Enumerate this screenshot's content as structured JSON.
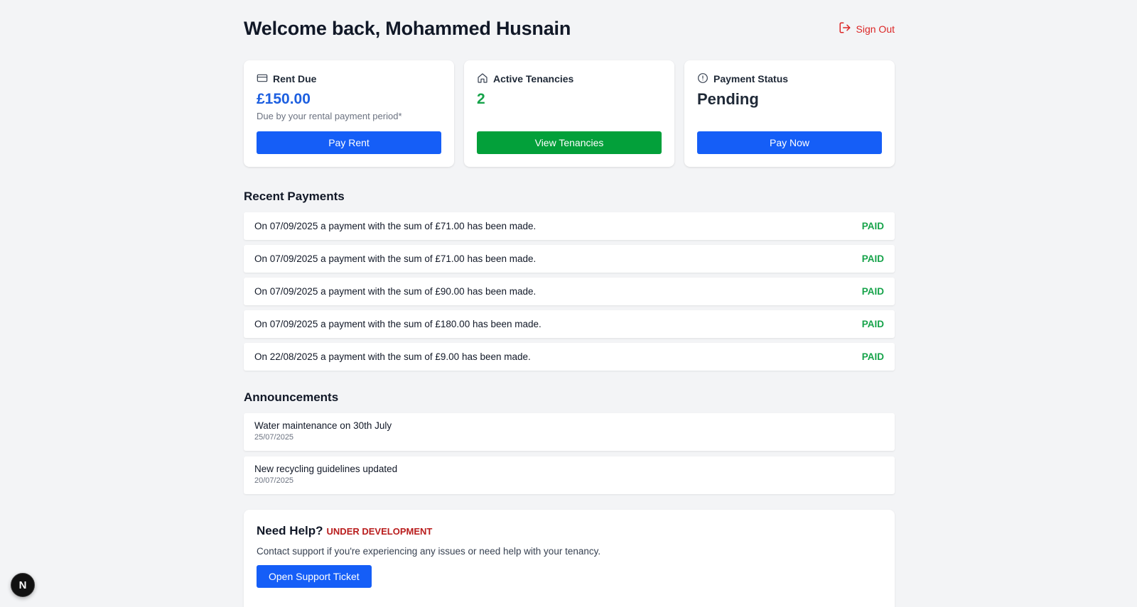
{
  "header": {
    "title": "Welcome back, Mohammed Husnain",
    "sign_out_label": "Sign Out"
  },
  "cards": {
    "rent_due": {
      "title": "Rent Due",
      "value": "£150.00",
      "subtitle": "Due by your rental payment period*",
      "button": "Pay Rent",
      "icon": "credit-card-icon"
    },
    "active_tenancies": {
      "title": "Active Tenancies",
      "value": "2",
      "button": "View Tenancies",
      "icon": "home-icon"
    },
    "payment_status": {
      "title": "Payment Status",
      "value": "Pending",
      "button": "Pay Now",
      "icon": "alert-circle-icon"
    }
  },
  "recent_payments": {
    "title": "Recent Payments",
    "items": [
      {
        "text": "On 07/09/2025 a payment with the sum of £71.00 has been made.",
        "status": "PAID"
      },
      {
        "text": "On 07/09/2025 a payment with the sum of £71.00 has been made.",
        "status": "PAID"
      },
      {
        "text": "On 07/09/2025 a payment with the sum of £90.00 has been made.",
        "status": "PAID"
      },
      {
        "text": "On 07/09/2025 a payment with the sum of £180.00 has been made.",
        "status": "PAID"
      },
      {
        "text": "On 22/08/2025 a payment with the sum of £9.00 has been made.",
        "status": "PAID"
      }
    ]
  },
  "announcements": {
    "title": "Announcements",
    "items": [
      {
        "text": "Water maintenance on 30th July",
        "date": "25/07/2025"
      },
      {
        "text": "New recycling guidelines updated",
        "date": "20/07/2025"
      }
    ]
  },
  "help": {
    "title": "Need Help?",
    "badge": "UNDER DEVELOPMENT",
    "description": "Contact support if you're experiencing any issues or need help with your tenancy.",
    "button": "Open Support Ticket"
  },
  "dev_badge": {
    "letter": "N"
  },
  "colors": {
    "primary": "#155ef7",
    "success": "#03a03a",
    "danger": "#dc2626",
    "paid": "#16a34a",
    "background": "#f3f4f6"
  }
}
